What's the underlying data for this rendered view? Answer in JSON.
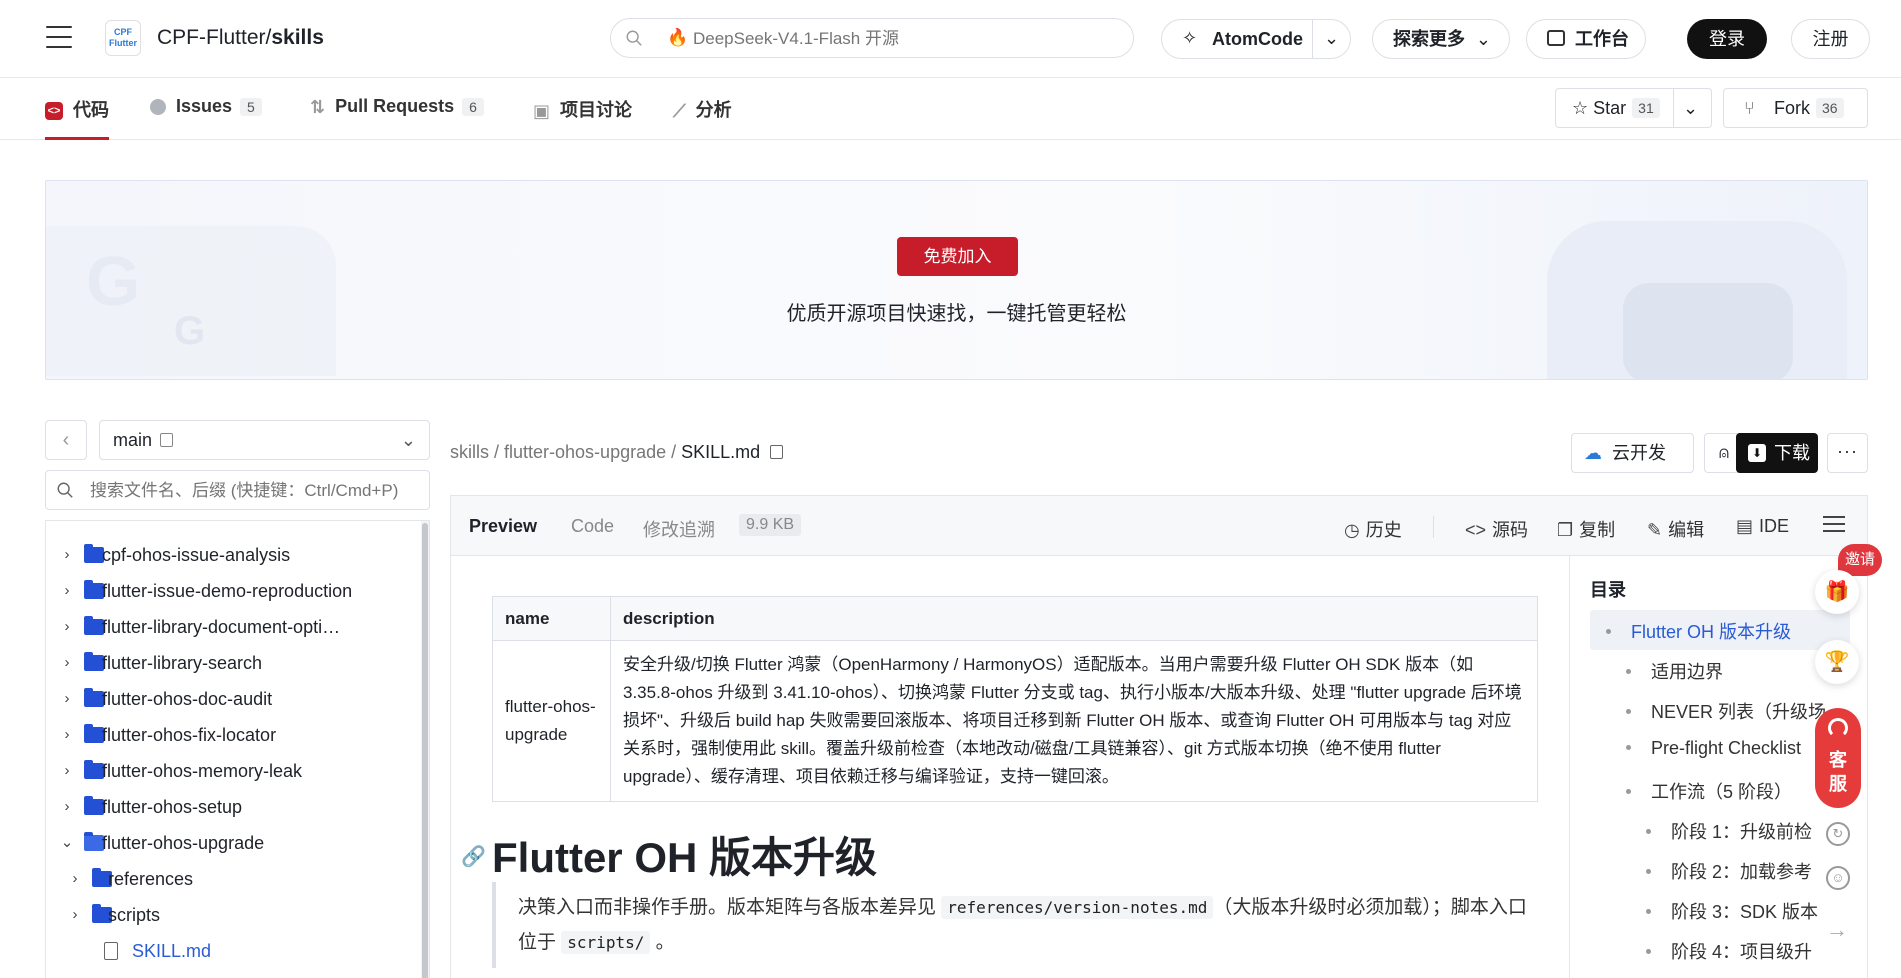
{
  "header": {
    "org_logo_text": "CPF\nFlutter",
    "repo_owner": "CPF-Flutter/",
    "repo_name": "skills",
    "search_placeholder": "DeepSeek-V4.1-Flash 开源",
    "atomcode_label": "AtomCode",
    "explore_label": "探索更多",
    "workbench_label": "工作台",
    "login_label": "登录",
    "register_label": "注册"
  },
  "tabs": [
    {
      "label": "代码",
      "count": null
    },
    {
      "label": "Issues",
      "count": "5"
    },
    {
      "label": "Pull Requests",
      "count": "6"
    },
    {
      "label": "项目讨论",
      "count": null
    },
    {
      "label": "分析",
      "count": null
    }
  ],
  "repo_actions": {
    "star_label": "Star",
    "star_count": "31",
    "fork_label": "Fork",
    "fork_count": "36"
  },
  "banner": {
    "join_label": "免费加入",
    "slogan": "优质开源项目快速找，一键托管更轻松"
  },
  "sidebar": {
    "branch": "main",
    "search_placeholder": "搜索文件名、后缀 (快捷键：Ctrl/Cmd+P)",
    "tree": [
      {
        "name": "cpf-ohos-issue-analysis",
        "type": "folder",
        "expanded": false,
        "level": 0
      },
      {
        "name": "flutter-issue-demo-reproduction",
        "type": "folder",
        "expanded": false,
        "level": 0
      },
      {
        "name": "flutter-library-document-opti…",
        "type": "folder",
        "expanded": false,
        "level": 0
      },
      {
        "name": "flutter-library-search",
        "type": "folder",
        "expanded": false,
        "level": 0
      },
      {
        "name": "flutter-ohos-doc-audit",
        "type": "folder",
        "expanded": false,
        "level": 0
      },
      {
        "name": "flutter-ohos-fix-locator",
        "type": "folder",
        "expanded": false,
        "level": 0
      },
      {
        "name": "flutter-ohos-memory-leak",
        "type": "folder",
        "expanded": false,
        "level": 0
      },
      {
        "name": "flutter-ohos-setup",
        "type": "folder",
        "expanded": false,
        "level": 0
      },
      {
        "name": "flutter-ohos-upgrade",
        "type": "folder",
        "expanded": true,
        "level": 0
      },
      {
        "name": "references",
        "type": "folder",
        "expanded": false,
        "level": 1
      },
      {
        "name": "scripts",
        "type": "folder",
        "expanded": false,
        "level": 1
      },
      {
        "name": "SKILL.md",
        "type": "file",
        "active": true,
        "level": 1
      }
    ]
  },
  "breadcrumb": {
    "part1": "skills",
    "sep": " / ",
    "part2": "flutter-ohos-upgrade",
    "current": "SKILL.md"
  },
  "file_actions": {
    "cloud_label": "云开发",
    "download_label": "下载",
    "more_label": "···"
  },
  "file_toolbar": {
    "preview_label": "Preview",
    "code_label": "Code",
    "blame_label": "修改追溯",
    "size": "9.9 KB",
    "history_label": "历史",
    "source_label": "源码",
    "copy_label": "复制",
    "edit_label": "编辑",
    "ide_label": "IDE"
  },
  "markdown": {
    "table_header_name": "name",
    "table_header_desc": "description",
    "table_name": "flutter-ohos-upgrade",
    "table_desc": "安全升级/切换 Flutter 鸿蒙（OpenHarmony / HarmonyOS）适配版本。当用户需要升级 Flutter OH SDK 版本（如 3.35.8-ohos 升级到 3.41.10-ohos）、切换鸿蒙 Flutter 分支或 tag、执行小版本/大版本升级、处理 \"flutter upgrade 后环境损坏\"、升级后 build hap 失败需要回滚版本、将项目迁移到新 Flutter OH 版本、或查询 Flutter OH 可用版本与 tag 对应关系时，强制使用此 skill。覆盖升级前检查（本地改动/磁盘/工具链兼容）、git 方式版本切换（绝不使用 flutter upgrade）、缓存清理、项目依赖迁移与编译验证，支持一键回滚。",
    "h1": "Flutter OH 版本升级",
    "quote_part1": "决策入口而非操作手册。版本矩阵与各版本差异见 ",
    "quote_code1": "references/version-notes.md",
    "quote_part2": "（大版本升级时必须加载）；脚本入口位于 ",
    "quote_code2": "scripts/",
    "quote_part3": " 。"
  },
  "toc": {
    "title": "目录",
    "items": [
      {
        "label": "Flutter OH 版本升级",
        "level": 0,
        "active": true
      },
      {
        "label": "适用边界",
        "level": 1
      },
      {
        "label": "NEVER 列表（升级场",
        "level": 1
      },
      {
        "label": "Pre-flight Checklist",
        "level": 1
      },
      {
        "label": "工作流（5 阶段）",
        "level": 1
      },
      {
        "label": "阶段 1：升级前检",
        "level": 2
      },
      {
        "label": "阶段 2：加载参考",
        "level": 2
      },
      {
        "label": "阶段 3：SDK 版本",
        "level": 2
      },
      {
        "label": "阶段 4：项目级升",
        "level": 2
      }
    ]
  },
  "floating": {
    "invite_label": "邀请",
    "service_label": "客服"
  },
  "colors": {
    "brand_red": "#c71d2b",
    "link_blue": "#2a5bd7",
    "folder_blue": "#2450d6"
  }
}
